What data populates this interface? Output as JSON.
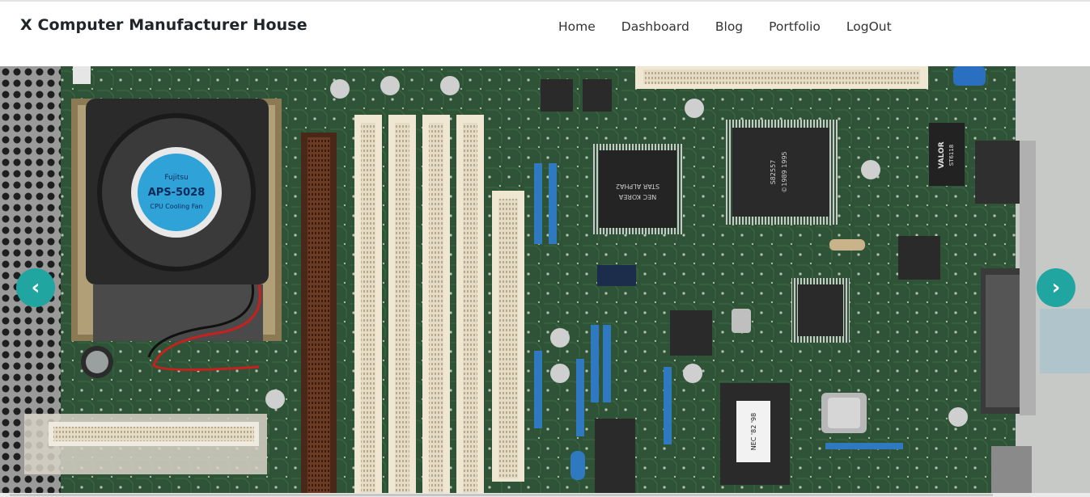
{
  "header": {
    "brand": "X Computer Manufacturer House"
  },
  "nav": {
    "items": [
      {
        "label": "Home"
      },
      {
        "label": "Dashboard"
      },
      {
        "label": "Blog"
      },
      {
        "label": "Portfolio"
      },
      {
        "label": "LogOut"
      }
    ]
  },
  "carousel": {
    "prev_label": "‹",
    "next_label": "›",
    "accent_color": "#21a5a0"
  },
  "slide": {
    "fan_line1": "Fujitsu",
    "fan_line2": "APS-5028",
    "fan_line3": "CPU Cooling Fan",
    "chip1_line1": "NEC KOREA",
    "chip1_line2": "STAR ALPHA2",
    "chip2_line1": "S82557",
    "chip2_line2": "©1989 1995",
    "label_valor": "VALOR",
    "label_valor2": "ST6118",
    "nec_label": "NEC '82 '98"
  }
}
